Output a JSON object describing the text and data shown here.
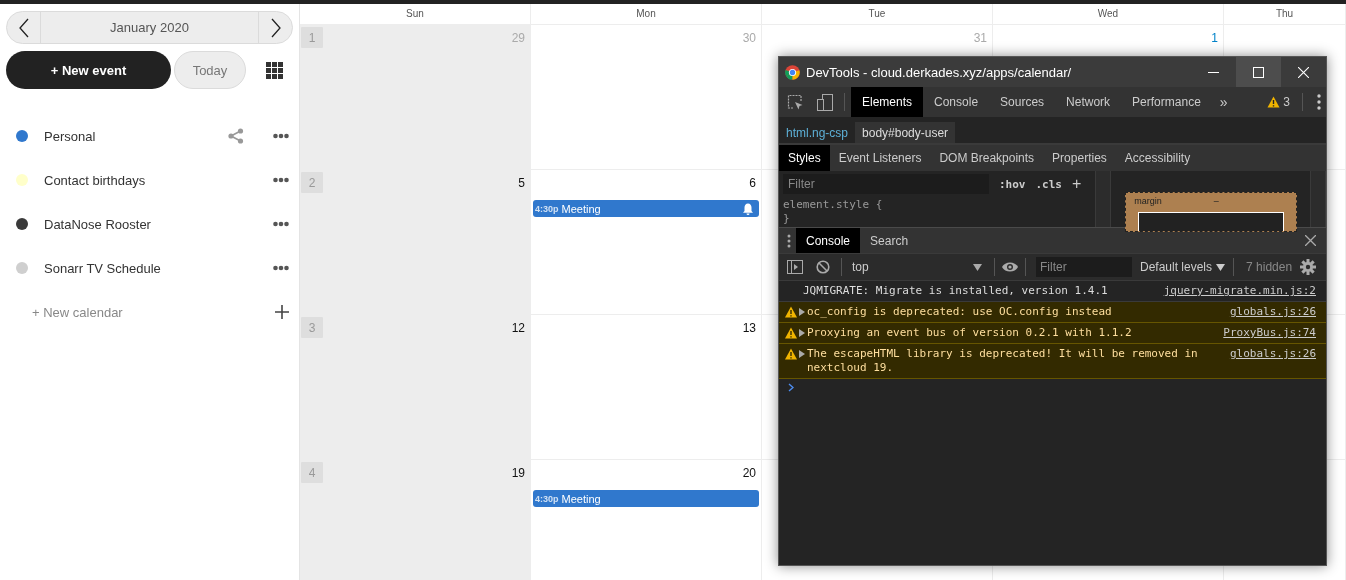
{
  "sidebar": {
    "month_label": "January 2020",
    "new_event_label": "+ New event",
    "today_label": "Today",
    "calendars": [
      {
        "name": "Personal",
        "color": "#3078cd",
        "shared": true
      },
      {
        "name": "Contact birthdays",
        "color": "#ffffca",
        "shared": false
      },
      {
        "name": "DataNose Rooster",
        "color": "#3a3a3a",
        "shared": false
      },
      {
        "name": "Sonarr TV Schedule",
        "color": "#cfcfcf",
        "shared": false
      }
    ],
    "new_calendar_label": "+ New calendar"
  },
  "calendar": {
    "columns": [
      {
        "label": "Sun",
        "weekend": true
      },
      {
        "label": "Mon",
        "weekend": false
      },
      {
        "label": "Tue",
        "weekend": false
      },
      {
        "label": "Wed",
        "weekend": false
      },
      {
        "label": "Thu",
        "weekend": false
      }
    ],
    "weeks": [
      {
        "number": "1",
        "days": [
          {
            "label": "29",
            "kind": "outside"
          },
          {
            "label": "30",
            "kind": "outside"
          },
          {
            "label": "31",
            "kind": "outside"
          },
          {
            "label": "1",
            "kind": "today"
          }
        ]
      },
      {
        "number": "2",
        "days": [
          {
            "label": "5",
            "kind": "current"
          },
          {
            "label": "6",
            "kind": "current",
            "events": [
              {
                "time": "4:30p",
                "title": "Meeting",
                "alarm": true
              }
            ]
          }
        ]
      },
      {
        "number": "3",
        "days": [
          {
            "label": "12",
            "kind": "current"
          },
          {
            "label": "13",
            "kind": "current"
          }
        ]
      },
      {
        "number": "4",
        "days": [
          {
            "label": "19",
            "kind": "current"
          },
          {
            "label": "20",
            "kind": "current",
            "events": [
              {
                "time": "4:30p",
                "title": "Meeting",
                "alarm": false
              }
            ]
          }
        ]
      }
    ]
  },
  "devtools": {
    "title": "DevTools - cloud.derkades.xyz/apps/calendar/",
    "tabs": [
      {
        "label": "Elements",
        "selected": true
      },
      {
        "label": "Console",
        "selected": false
      },
      {
        "label": "Sources",
        "selected": false
      },
      {
        "label": "Network",
        "selected": false
      },
      {
        "label": "Performance",
        "selected": false
      }
    ],
    "more_tabs_glyph": "»",
    "warning_count": "3",
    "breadcrumbs": [
      {
        "label": "html.ng-csp",
        "selected": false
      },
      {
        "label": "body#body-user",
        "selected": true
      }
    ],
    "sub_tabs": [
      {
        "label": "Styles",
        "selected": true
      },
      {
        "label": "Event Listeners",
        "selected": false
      },
      {
        "label": "DOM Breakpoints",
        "selected": false
      },
      {
        "label": "Properties",
        "selected": false
      },
      {
        "label": "Accessibility",
        "selected": false
      }
    ],
    "styles_filter": {
      "placeholder": "Filter"
    },
    "hov_label": ":hov",
    "cls_label": ".cls",
    "add_rule_glyph": "+",
    "style_rule_lines": [
      "element.style {",
      "}"
    ],
    "box_model_label": "margin",
    "box_model_value": "–",
    "drawer_tabs": [
      {
        "label": "Console",
        "selected": true
      },
      {
        "label": "Search",
        "selected": false
      }
    ],
    "console_context": "top",
    "console_filter": {
      "placeholder": "Filter"
    },
    "levels_label": "Default levels",
    "hidden_count": "7 hidden",
    "messages": [
      {
        "kind": "info",
        "expandable": false,
        "text": "JQMIGRATE: Migrate is installed, version 1.4.1",
        "source": "jquery-migrate.min.js:2"
      },
      {
        "kind": "warning",
        "expandable": true,
        "text": "oc_config is deprecated: use OC.config instead",
        "source": "globals.js:26"
      },
      {
        "kind": "warning",
        "expandable": true,
        "text": "Proxying an event bus of version 0.2.1 with 1.1.2",
        "source": "ProxyBus.js:74"
      },
      {
        "kind": "warning",
        "expandable": true,
        "text": "The escapeHTML library is deprecated! It will be removed in nextcloud 19.",
        "source": "globals.js:26"
      }
    ]
  }
}
